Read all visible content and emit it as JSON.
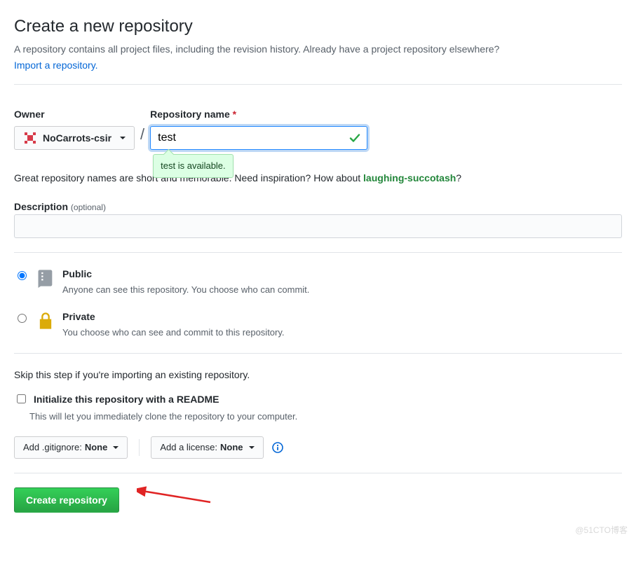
{
  "header": {
    "title": "Create a new repository",
    "subhead": "A repository contains all project files, including the revision history. Already have a project repository elsewhere?",
    "import_link": "Import a repository."
  },
  "owner": {
    "label": "Owner",
    "selected": "NoCarrots-csir"
  },
  "repo": {
    "label": "Repository name",
    "required_marker": "*",
    "value": "test",
    "availability_tip": "test is available.",
    "hint_prefix": "Great repository names are short and memorable. Need inspiration? How about ",
    "suggestion": "laughing-succotash",
    "hint_suffix": "?"
  },
  "description": {
    "label": "Description",
    "optional_label": "(optional)",
    "value": ""
  },
  "visibility": {
    "public": {
      "title": "Public",
      "desc": "Anyone can see this repository. You choose who can commit."
    },
    "private": {
      "title": "Private",
      "desc": "You choose who can see and commit to this repository."
    }
  },
  "skip_text": "Skip this step if you're importing an existing repository.",
  "readme": {
    "title": "Initialize this repository with a README",
    "desc": "This will let you immediately clone the repository to your computer."
  },
  "buttons": {
    "gitignore_prefix": "Add .gitignore: ",
    "gitignore_value": "None",
    "license_prefix": "Add a license: ",
    "license_value": "None",
    "create": "Create repository"
  },
  "watermark": "@51CTO博客"
}
